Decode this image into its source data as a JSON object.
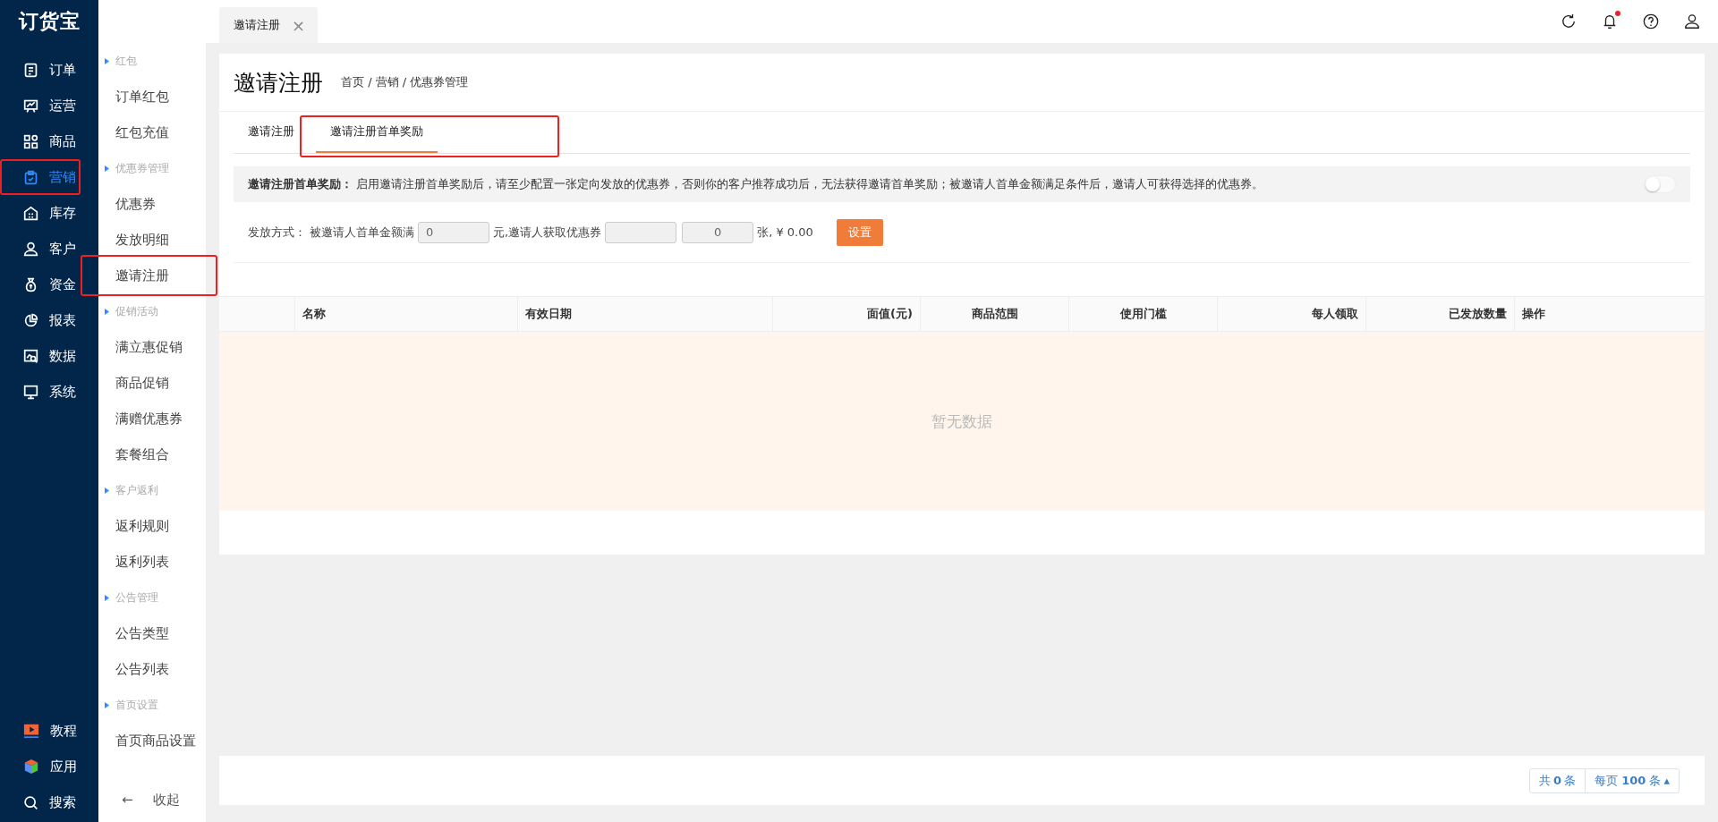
{
  "logo": "订货宝",
  "nav": [
    {
      "label": "订单",
      "selected": false,
      "annotated": false
    },
    {
      "label": "运营",
      "selected": false,
      "annotated": false
    },
    {
      "label": "商品",
      "selected": false,
      "annotated": false
    },
    {
      "label": "营销",
      "selected": true,
      "annotated": true
    },
    {
      "label": "库存",
      "selected": false,
      "annotated": false
    },
    {
      "label": "客户",
      "selected": false,
      "annotated": false
    },
    {
      "label": "资金",
      "selected": false,
      "annotated": false
    },
    {
      "label": "报表",
      "selected": false,
      "annotated": false
    },
    {
      "label": "数据",
      "selected": false,
      "annotated": false
    },
    {
      "label": "系统",
      "selected": false,
      "annotated": false
    }
  ],
  "nav_bottom": [
    {
      "label": "教程"
    },
    {
      "label": "应用"
    },
    {
      "label": "搜索"
    }
  ],
  "submenu": [
    {
      "group": "红包",
      "items": [
        {
          "label": "订单红包",
          "annotated": false
        },
        {
          "label": "红包充值",
          "annotated": false
        }
      ]
    },
    {
      "group": "优惠券管理",
      "items": [
        {
          "label": "优惠券",
          "annotated": false
        },
        {
          "label": "发放明细",
          "annotated": false
        },
        {
          "label": "邀请注册",
          "annotated": true
        }
      ]
    },
    {
      "group": "促销活动",
      "items": [
        {
          "label": "满立惠促销",
          "annotated": false
        },
        {
          "label": "商品促销",
          "annotated": false
        },
        {
          "label": "满赠优惠券",
          "annotated": false
        },
        {
          "label": "套餐组合",
          "annotated": false
        }
      ]
    },
    {
      "group": "客户返利",
      "items": [
        {
          "label": "返利规则",
          "annotated": false
        },
        {
          "label": "返利列表",
          "annotated": false
        }
      ]
    },
    {
      "group": "公告管理",
      "items": [
        {
          "label": "公告类型",
          "annotated": false
        },
        {
          "label": "公告列表",
          "annotated": false
        }
      ]
    },
    {
      "group": "首页设置",
      "items": [
        {
          "label": "首页商品设置",
          "annotated": false
        }
      ]
    }
  ],
  "collapse": {
    "arrow": "←",
    "label": "收起"
  },
  "page_tabs": [
    {
      "label": "邀请注册",
      "close": "×"
    }
  ],
  "header_icons": [
    {
      "badge": false
    },
    {
      "badge": true
    },
    {
      "badge": false
    },
    {
      "badge": false
    }
  ],
  "title": "邀请注册",
  "breadcrumb": "首页 / 营销 / 优惠券管理",
  "tabs": {
    "annotated": true,
    "items": [
      {
        "label": "邀请注册",
        "selected": false
      },
      {
        "label": "邀请注册首单奖励",
        "selected": true
      }
    ]
  },
  "notice": {
    "text": "**邀请注册首单奖励：** 启用邀请注册首单奖励后，请至少配置一张定向发放的优惠券，否则你的客户推荐成功后，无法获得邀请首单奖励；被邀请人首单金额满足条件后，邀请人可获得选择的优惠券。",
    "on": false
  },
  "form": {
    "label": "发放方式：",
    "prefix": "被邀请人首单金额满",
    "amount": "0",
    "middle": "元,邀请人获取优惠券",
    "coupon_count": "0",
    "suffix": "张, ¥ 0.00",
    "button": "设置"
  },
  "table": {
    "columns": [
      "名称",
      "有效日期",
      "面值(元)",
      "商品范围",
      "使用门槛",
      "每人领取",
      "已发放数量",
      "操作"
    ],
    "empty": "暂无数据"
  },
  "pagination": {
    "total": "共 **0** 条",
    "per_page": "每页 **100** 条",
    "caret": "▴"
  }
}
